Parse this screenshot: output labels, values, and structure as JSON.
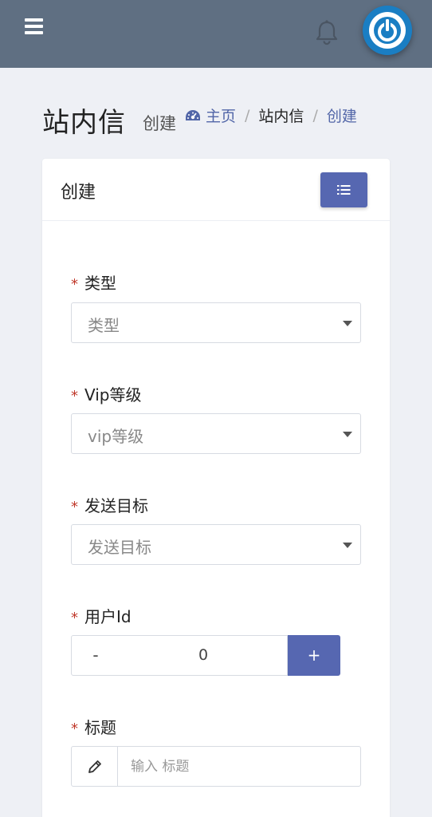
{
  "header": {
    "menu_icon": "hamburger-icon",
    "notification_icon": "bell-icon",
    "avatar_icon": "power-icon",
    "background_color": "#5f6f82",
    "avatar_color": "#1a7ec3"
  },
  "page": {
    "title": "站内信",
    "subtitle": "创建",
    "breadcrumb": {
      "home_icon": "dashboard-icon",
      "home": "主页",
      "middle": "站内信",
      "current": "创建",
      "separator": "/"
    }
  },
  "card": {
    "title": "创建",
    "list_button_icon": "list-icon",
    "accent_color": "#5667b1"
  },
  "form": {
    "required_mark": "*",
    "type": {
      "label": "类型",
      "placeholder": "类型"
    },
    "vip_level": {
      "label": "Vip等级",
      "placeholder": "vip等级"
    },
    "target": {
      "label": "发送目标",
      "placeholder": "发送目标"
    },
    "user_id": {
      "label": "用户Id",
      "minus": "-",
      "value": "0",
      "plus": "+"
    },
    "subject": {
      "label": "标题",
      "placeholder": "输入 标题",
      "icon": "pencil-icon"
    }
  }
}
